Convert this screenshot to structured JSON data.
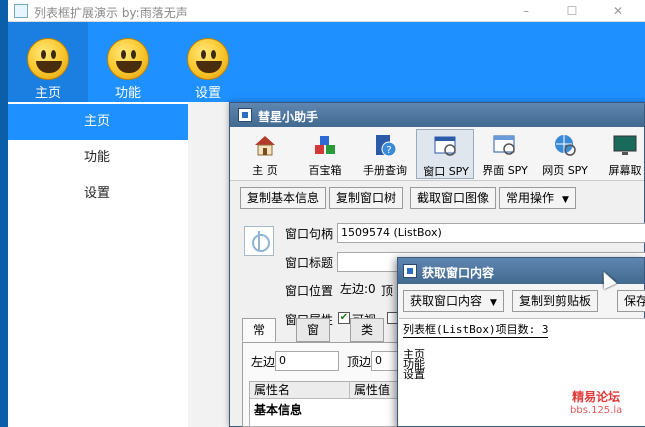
{
  "demo_window": {
    "title": "列表框扩展演示  by:雨落无声",
    "controls": {
      "minimize": "–",
      "maximize": "☐",
      "close": "✕"
    },
    "nav_tabs": [
      {
        "label": "主页",
        "icon": "smiley-icon"
      },
      {
        "label": "功能",
        "icon": "smiley-icon"
      },
      {
        "label": "设置",
        "icon": "smiley-icon"
      }
    ],
    "active_tab": 0,
    "sidebar_items": [
      "主页",
      "功能",
      "设置"
    ],
    "active_sidebar_item": 0,
    "colors": {
      "accent": "#1e90ff",
      "active_tab": "#1a7fe0"
    }
  },
  "helper_window": {
    "title": "彗星小助手",
    "toolbar": [
      {
        "label": "主 页",
        "icon": "house-icon"
      },
      {
        "label": "百宝箱",
        "icon": "cubes-icon"
      },
      {
        "label": "手册查询",
        "icon": "help-book-icon"
      },
      {
        "label": "窗口 SPY",
        "icon": "window-spy-icon"
      },
      {
        "label": "界面 SPY",
        "icon": "ui-spy-icon"
      },
      {
        "label": "网页 SPY",
        "icon": "web-spy-icon"
      },
      {
        "label": "屏幕取",
        "icon": "screen-capture-icon"
      }
    ],
    "active_toolbar": 3,
    "actions": [
      {
        "label": "复制基本信息"
      },
      {
        "label": "复制窗口树"
      },
      {
        "label": "截取窗口图像"
      },
      {
        "label": "常用操作",
        "dropdown": true
      }
    ],
    "fields": {
      "handle_label": "窗口句柄",
      "handle_value": "1509574 (ListBox)",
      "title_label": "窗口标题",
      "title_value": "",
      "position_label": "窗口位置",
      "left_prefix": "左边:0",
      "top_prefix": "顶",
      "attr_label": "窗口属性",
      "visible_label": "可视",
      "visible_checked": true
    },
    "tabs": [
      "常规",
      "窗口",
      "类"
    ],
    "active_tab": 0,
    "row": {
      "left_label": "左边",
      "left_value": "0",
      "top_label": "顶边",
      "top_value": "0"
    },
    "table_headers": [
      "属性名",
      "属性值"
    ],
    "table_rows": [
      "基本信息"
    ]
  },
  "getwin_window": {
    "title": "获取窗口内容",
    "actions": [
      {
        "label": "获取窗口内容",
        "dropdown": true
      },
      {
        "label": "复制到剪贴板"
      },
      {
        "label": "保存"
      }
    ],
    "count_line": "列表框(ListBox)项目数: 3",
    "items": [
      "主页",
      "功能",
      "设置"
    ]
  },
  "watermark": {
    "line1": "精易论坛",
    "line2": "bbs.125.la"
  }
}
